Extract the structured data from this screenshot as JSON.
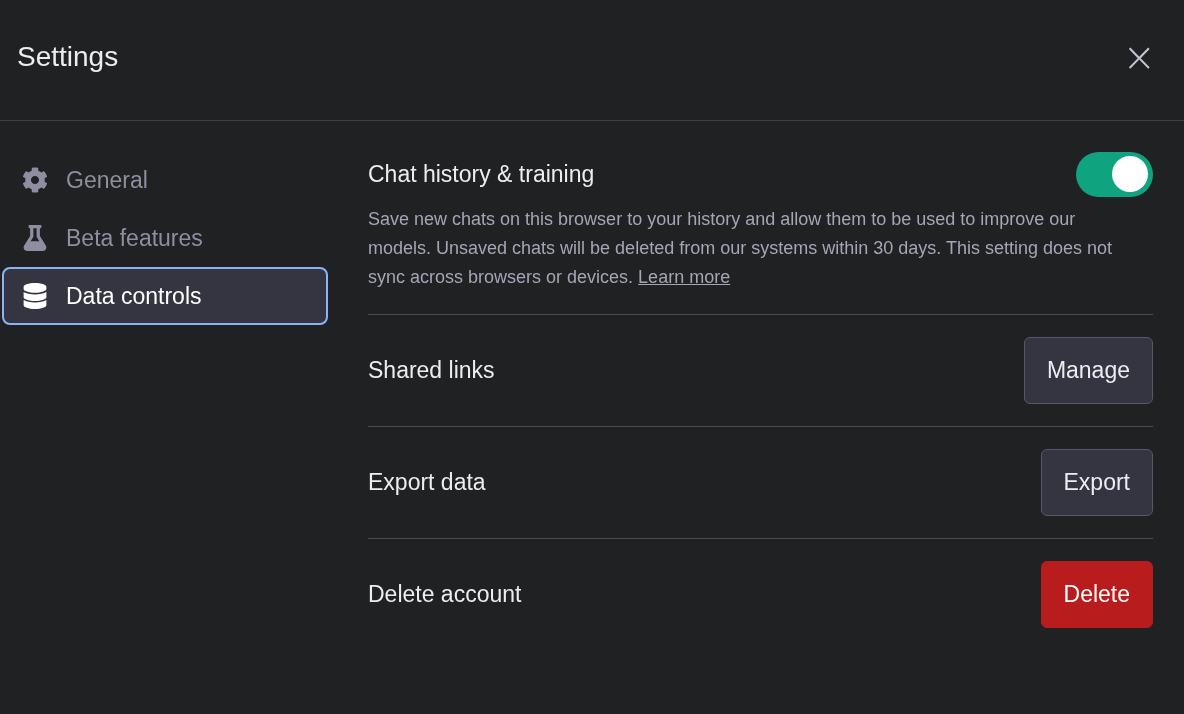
{
  "dialog": {
    "title": "Settings",
    "close_label": "×"
  },
  "sidebar": {
    "items": [
      {
        "kind": "gear",
        "label": "General",
        "selected": false
      },
      {
        "kind": "flask",
        "label": "Beta features",
        "selected": false
      },
      {
        "kind": "database",
        "label": "Data controls",
        "selected": true
      }
    ]
  },
  "settings": [
    {
      "kind": "toggle",
      "label": "Chat history & training",
      "on": true,
      "description": "Save new chats on this browser to your history and allow them to be used to improve our models. Unsaved chats will be deleted from our systems within 30 days. This setting does not sync across browsers or devices.",
      "link": "Learn more"
    },
    {
      "kind": "button",
      "label": "Shared links",
      "button": {
        "label": "Manage",
        "kind": "secondary"
      }
    },
    {
      "kind": "button",
      "label": "Export data",
      "button": {
        "label": "Export",
        "kind": "secondary"
      }
    },
    {
      "kind": "button",
      "label": "Delete account",
      "button": {
        "label": "Delete",
        "kind": "danger"
      }
    }
  ]
}
